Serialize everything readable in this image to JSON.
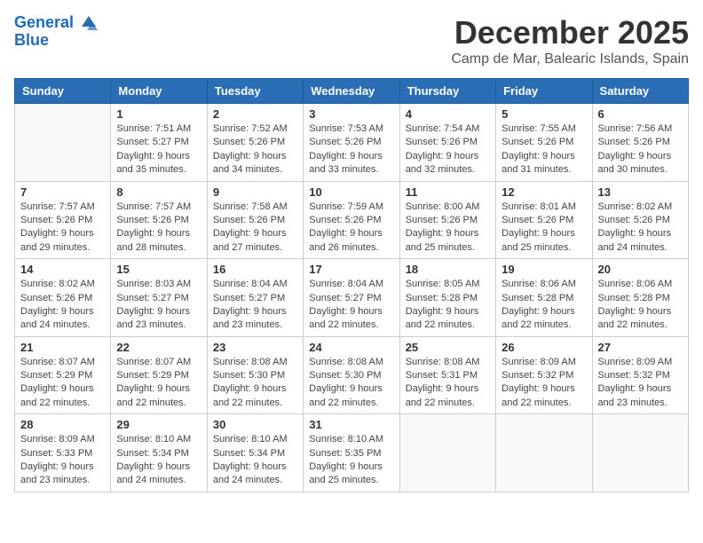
{
  "header": {
    "logo_line1": "General",
    "logo_line2": "Blue",
    "title": "December 2025",
    "subtitle": "Camp de Mar, Balearic Islands, Spain"
  },
  "weekdays": [
    "Sunday",
    "Monday",
    "Tuesday",
    "Wednesday",
    "Thursday",
    "Friday",
    "Saturday"
  ],
  "weeks": [
    [
      {
        "day": "",
        "info": ""
      },
      {
        "day": "1",
        "info": "Sunrise: 7:51 AM\nSunset: 5:27 PM\nDaylight: 9 hours\nand 35 minutes."
      },
      {
        "day": "2",
        "info": "Sunrise: 7:52 AM\nSunset: 5:26 PM\nDaylight: 9 hours\nand 34 minutes."
      },
      {
        "day": "3",
        "info": "Sunrise: 7:53 AM\nSunset: 5:26 PM\nDaylight: 9 hours\nand 33 minutes."
      },
      {
        "day": "4",
        "info": "Sunrise: 7:54 AM\nSunset: 5:26 PM\nDaylight: 9 hours\nand 32 minutes."
      },
      {
        "day": "5",
        "info": "Sunrise: 7:55 AM\nSunset: 5:26 PM\nDaylight: 9 hours\nand 31 minutes."
      },
      {
        "day": "6",
        "info": "Sunrise: 7:56 AM\nSunset: 5:26 PM\nDaylight: 9 hours\nand 30 minutes."
      }
    ],
    [
      {
        "day": "7",
        "info": "Sunrise: 7:57 AM\nSunset: 5:26 PM\nDaylight: 9 hours\nand 29 minutes."
      },
      {
        "day": "8",
        "info": "Sunrise: 7:57 AM\nSunset: 5:26 PM\nDaylight: 9 hours\nand 28 minutes."
      },
      {
        "day": "9",
        "info": "Sunrise: 7:58 AM\nSunset: 5:26 PM\nDaylight: 9 hours\nand 27 minutes."
      },
      {
        "day": "10",
        "info": "Sunrise: 7:59 AM\nSunset: 5:26 PM\nDaylight: 9 hours\nand 26 minutes."
      },
      {
        "day": "11",
        "info": "Sunrise: 8:00 AM\nSunset: 5:26 PM\nDaylight: 9 hours\nand 25 minutes."
      },
      {
        "day": "12",
        "info": "Sunrise: 8:01 AM\nSunset: 5:26 PM\nDaylight: 9 hours\nand 25 minutes."
      },
      {
        "day": "13",
        "info": "Sunrise: 8:02 AM\nSunset: 5:26 PM\nDaylight: 9 hours\nand 24 minutes."
      }
    ],
    [
      {
        "day": "14",
        "info": "Sunrise: 8:02 AM\nSunset: 5:26 PM\nDaylight: 9 hours\nand 24 minutes."
      },
      {
        "day": "15",
        "info": "Sunrise: 8:03 AM\nSunset: 5:27 PM\nDaylight: 9 hours\nand 23 minutes."
      },
      {
        "day": "16",
        "info": "Sunrise: 8:04 AM\nSunset: 5:27 PM\nDaylight: 9 hours\nand 23 minutes."
      },
      {
        "day": "17",
        "info": "Sunrise: 8:04 AM\nSunset: 5:27 PM\nDaylight: 9 hours\nand 22 minutes."
      },
      {
        "day": "18",
        "info": "Sunrise: 8:05 AM\nSunset: 5:28 PM\nDaylight: 9 hours\nand 22 minutes."
      },
      {
        "day": "19",
        "info": "Sunrise: 8:06 AM\nSunset: 5:28 PM\nDaylight: 9 hours\nand 22 minutes."
      },
      {
        "day": "20",
        "info": "Sunrise: 8:06 AM\nSunset: 5:28 PM\nDaylight: 9 hours\nand 22 minutes."
      }
    ],
    [
      {
        "day": "21",
        "info": "Sunrise: 8:07 AM\nSunset: 5:29 PM\nDaylight: 9 hours\nand 22 minutes."
      },
      {
        "day": "22",
        "info": "Sunrise: 8:07 AM\nSunset: 5:29 PM\nDaylight: 9 hours\nand 22 minutes."
      },
      {
        "day": "23",
        "info": "Sunrise: 8:08 AM\nSunset: 5:30 PM\nDaylight: 9 hours\nand 22 minutes."
      },
      {
        "day": "24",
        "info": "Sunrise: 8:08 AM\nSunset: 5:30 PM\nDaylight: 9 hours\nand 22 minutes."
      },
      {
        "day": "25",
        "info": "Sunrise: 8:08 AM\nSunset: 5:31 PM\nDaylight: 9 hours\nand 22 minutes."
      },
      {
        "day": "26",
        "info": "Sunrise: 8:09 AM\nSunset: 5:32 PM\nDaylight: 9 hours\nand 22 minutes."
      },
      {
        "day": "27",
        "info": "Sunrise: 8:09 AM\nSunset: 5:32 PM\nDaylight: 9 hours\nand 23 minutes."
      }
    ],
    [
      {
        "day": "28",
        "info": "Sunrise: 8:09 AM\nSunset: 5:33 PM\nDaylight: 9 hours\nand 23 minutes."
      },
      {
        "day": "29",
        "info": "Sunrise: 8:10 AM\nSunset: 5:34 PM\nDaylight: 9 hours\nand 24 minutes."
      },
      {
        "day": "30",
        "info": "Sunrise: 8:10 AM\nSunset: 5:34 PM\nDaylight: 9 hours\nand 24 minutes."
      },
      {
        "day": "31",
        "info": "Sunrise: 8:10 AM\nSunset: 5:35 PM\nDaylight: 9 hours\nand 25 minutes."
      },
      {
        "day": "",
        "info": ""
      },
      {
        "day": "",
        "info": ""
      },
      {
        "day": "",
        "info": ""
      }
    ]
  ]
}
